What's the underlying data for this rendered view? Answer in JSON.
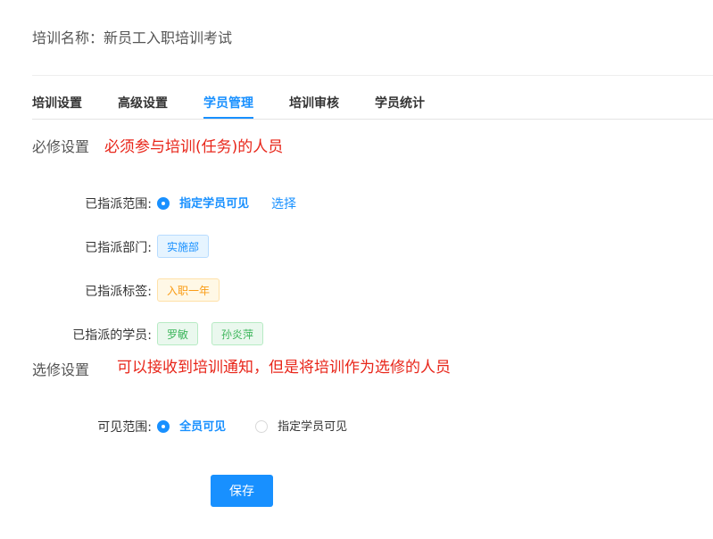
{
  "header": {
    "training_name": "培训名称：新员工入职培训考试"
  },
  "tabs": [
    {
      "label": "培训设置",
      "active": false
    },
    {
      "label": "高级设置",
      "active": false
    },
    {
      "label": "学员管理",
      "active": true
    },
    {
      "label": "培训审核",
      "active": false
    },
    {
      "label": "学员统计",
      "active": false
    }
  ],
  "required_section": {
    "title": "必修设置",
    "note": "必须参与培训(任务)的人员",
    "assign_scope": {
      "label": "已指派范围:",
      "option": "指定学员可见",
      "select_link": "选择"
    },
    "departments": {
      "label": "已指派部门:",
      "tags": [
        "实施部"
      ]
    },
    "labels": {
      "label": "已指派标签:",
      "tags": [
        "入职一年"
      ]
    },
    "students": {
      "label": "已指派的学员:",
      "tags": [
        "罗敏",
        "孙炎萍"
      ]
    }
  },
  "elective_section": {
    "title": "选修设置",
    "note": "可以接收到培训通知，但是将培训作为选修的人员",
    "visible_scope": {
      "label": "可见范围:",
      "options": [
        "全员可见",
        "指定学员可见"
      ],
      "selected": "全员可见"
    }
  },
  "actions": {
    "save_label": "保存"
  },
  "colors": {
    "accent": "#1890ff",
    "note_red": "#e8261a"
  }
}
